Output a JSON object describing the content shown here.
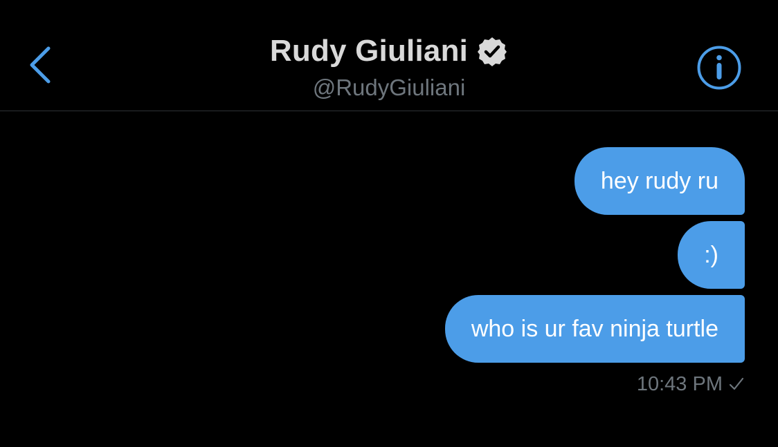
{
  "header": {
    "title": "Rudy Giuliani",
    "handle": "@RudyGiuliani",
    "back_icon": "chevron-left-icon",
    "verified_icon": "verified-badge-icon",
    "info_icon": "info-icon"
  },
  "messages": [
    {
      "text": "hey rudy ru"
    },
    {
      "text": ":)"
    },
    {
      "text": "who is ur fav ninja turtle"
    }
  ],
  "status": {
    "time": "10:43 PM",
    "read_icon": "check-icon"
  },
  "colors": {
    "background": "#000000",
    "accent": "#4c9de8",
    "title": "#d9d9d9",
    "muted": "#6e767d"
  }
}
